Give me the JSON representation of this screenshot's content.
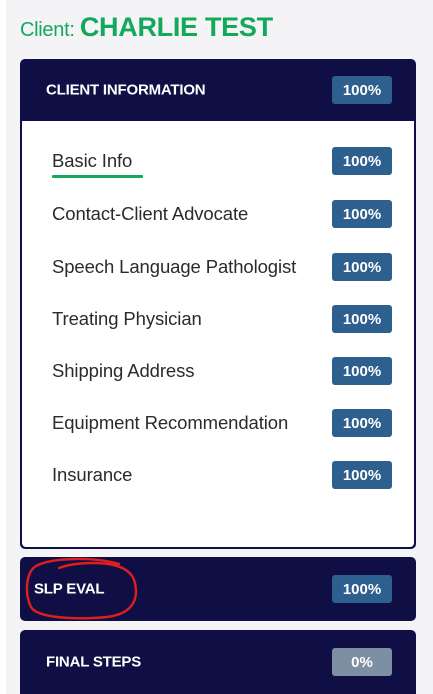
{
  "client": {
    "prefix": "Client: ",
    "name": "CHARLIE TEST"
  },
  "sections": {
    "client_information": {
      "title": "CLIENT INFORMATION",
      "percent": "100%",
      "items": [
        {
          "label": "Basic Info",
          "percent": "100%",
          "active": true
        },
        {
          "label": "Contact-Client Advocate",
          "percent": "100%"
        },
        {
          "label": "Speech Language Pathologist",
          "percent": "100%"
        },
        {
          "label": "Treating Physician",
          "percent": "100%"
        },
        {
          "label": "Shipping Address",
          "percent": "100%"
        },
        {
          "label": "Equipment Recommendation",
          "percent": "100%"
        },
        {
          "label": "Insurance",
          "percent": "100%"
        }
      ]
    },
    "slp_eval": {
      "title": "SLP EVAL",
      "percent": "100%"
    },
    "final_steps": {
      "title": "FINAL STEPS",
      "percent": "0%"
    }
  },
  "colors": {
    "panel_background": "#0f0f45",
    "badge_complete": "#2d5f8f",
    "badge_incomplete": "#7d8fa3",
    "client_name": "#14a85a",
    "active_underline": "#14a85a",
    "annotation_circle": "#e01e1e"
  }
}
